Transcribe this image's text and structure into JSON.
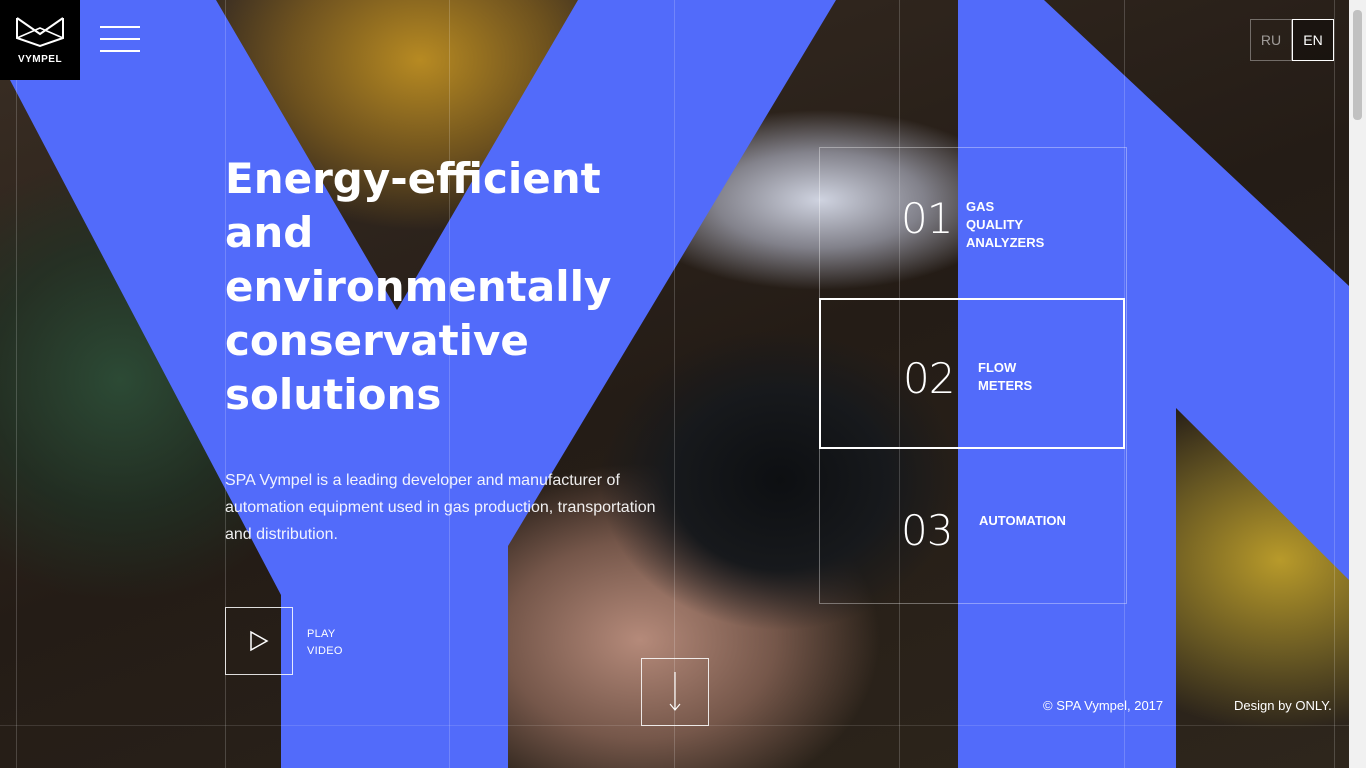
{
  "brand": {
    "logo_text": "VYMPEL"
  },
  "header": {
    "menu_icon": "hamburger-icon"
  },
  "languages": [
    {
      "code": "RU",
      "active": false
    },
    {
      "code": "EN",
      "active": true
    }
  ],
  "hero": {
    "headline": [
      "Energy-efficient",
      "and",
      "environmentally",
      "conservative",
      "solutions"
    ],
    "description": "SPA Vympel is a leading developer and manufacturer of automation equipment used in gas production, transportation and distribution.",
    "play_label": [
      "PLAY",
      "VIDEO"
    ],
    "play_icon": "play-icon",
    "scroll_icon": "arrow-down-icon"
  },
  "products": [
    {
      "number": "01",
      "title": [
        "GAS",
        "QUALITY",
        "ANALYZERS"
      ],
      "active": false
    },
    {
      "number": "02",
      "title": [
        "FLOW",
        "METERS"
      ],
      "active": true
    },
    {
      "number": "03",
      "title": [
        "AUTOMATION"
      ],
      "active": false
    }
  ],
  "footer": {
    "copyright": "© SPA Vympel, 2017",
    "credit": "Design by ONLY."
  },
  "colors": {
    "accent": "#526bfa",
    "logo_bg": "#000000",
    "text": "#ffffff"
  }
}
